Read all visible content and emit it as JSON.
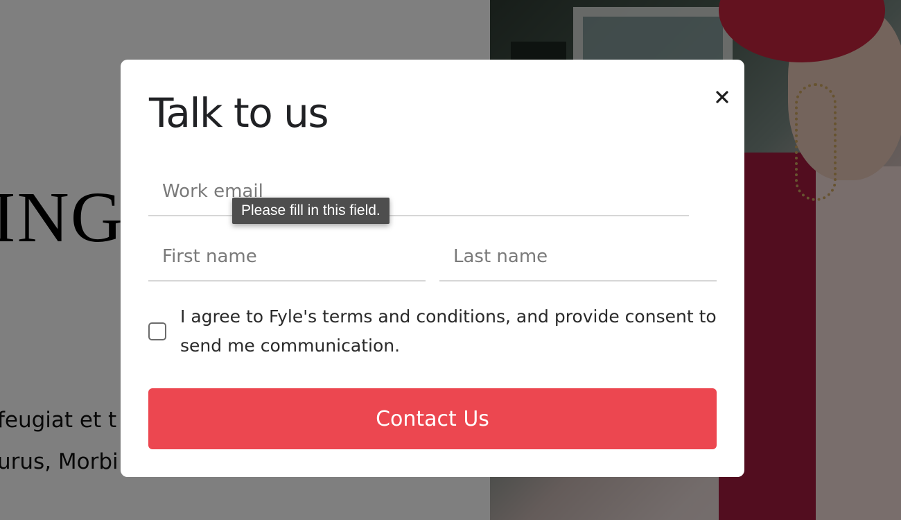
{
  "background": {
    "headline": "ING",
    "text_lines": [
      "feugiat et t",
      "urus, Morbi"
    ]
  },
  "modal": {
    "title": "Talk to us",
    "close_icon": "close-icon",
    "fields": {
      "email_placeholder": "Work email",
      "first_name_placeholder": "First name",
      "last_name_placeholder": "Last name"
    },
    "validation_tooltip": "Please fill in this field.",
    "consent": {
      "checked": false,
      "text": "I agree to Fyle's terms and conditions, and provide consent to send me communication."
    },
    "submit_label": "Contact Us"
  },
  "colors": {
    "accent": "#ec4750",
    "overlay": "rgba(0,0,0,0.5)",
    "tooltip_bg": "#4e4e4e"
  }
}
